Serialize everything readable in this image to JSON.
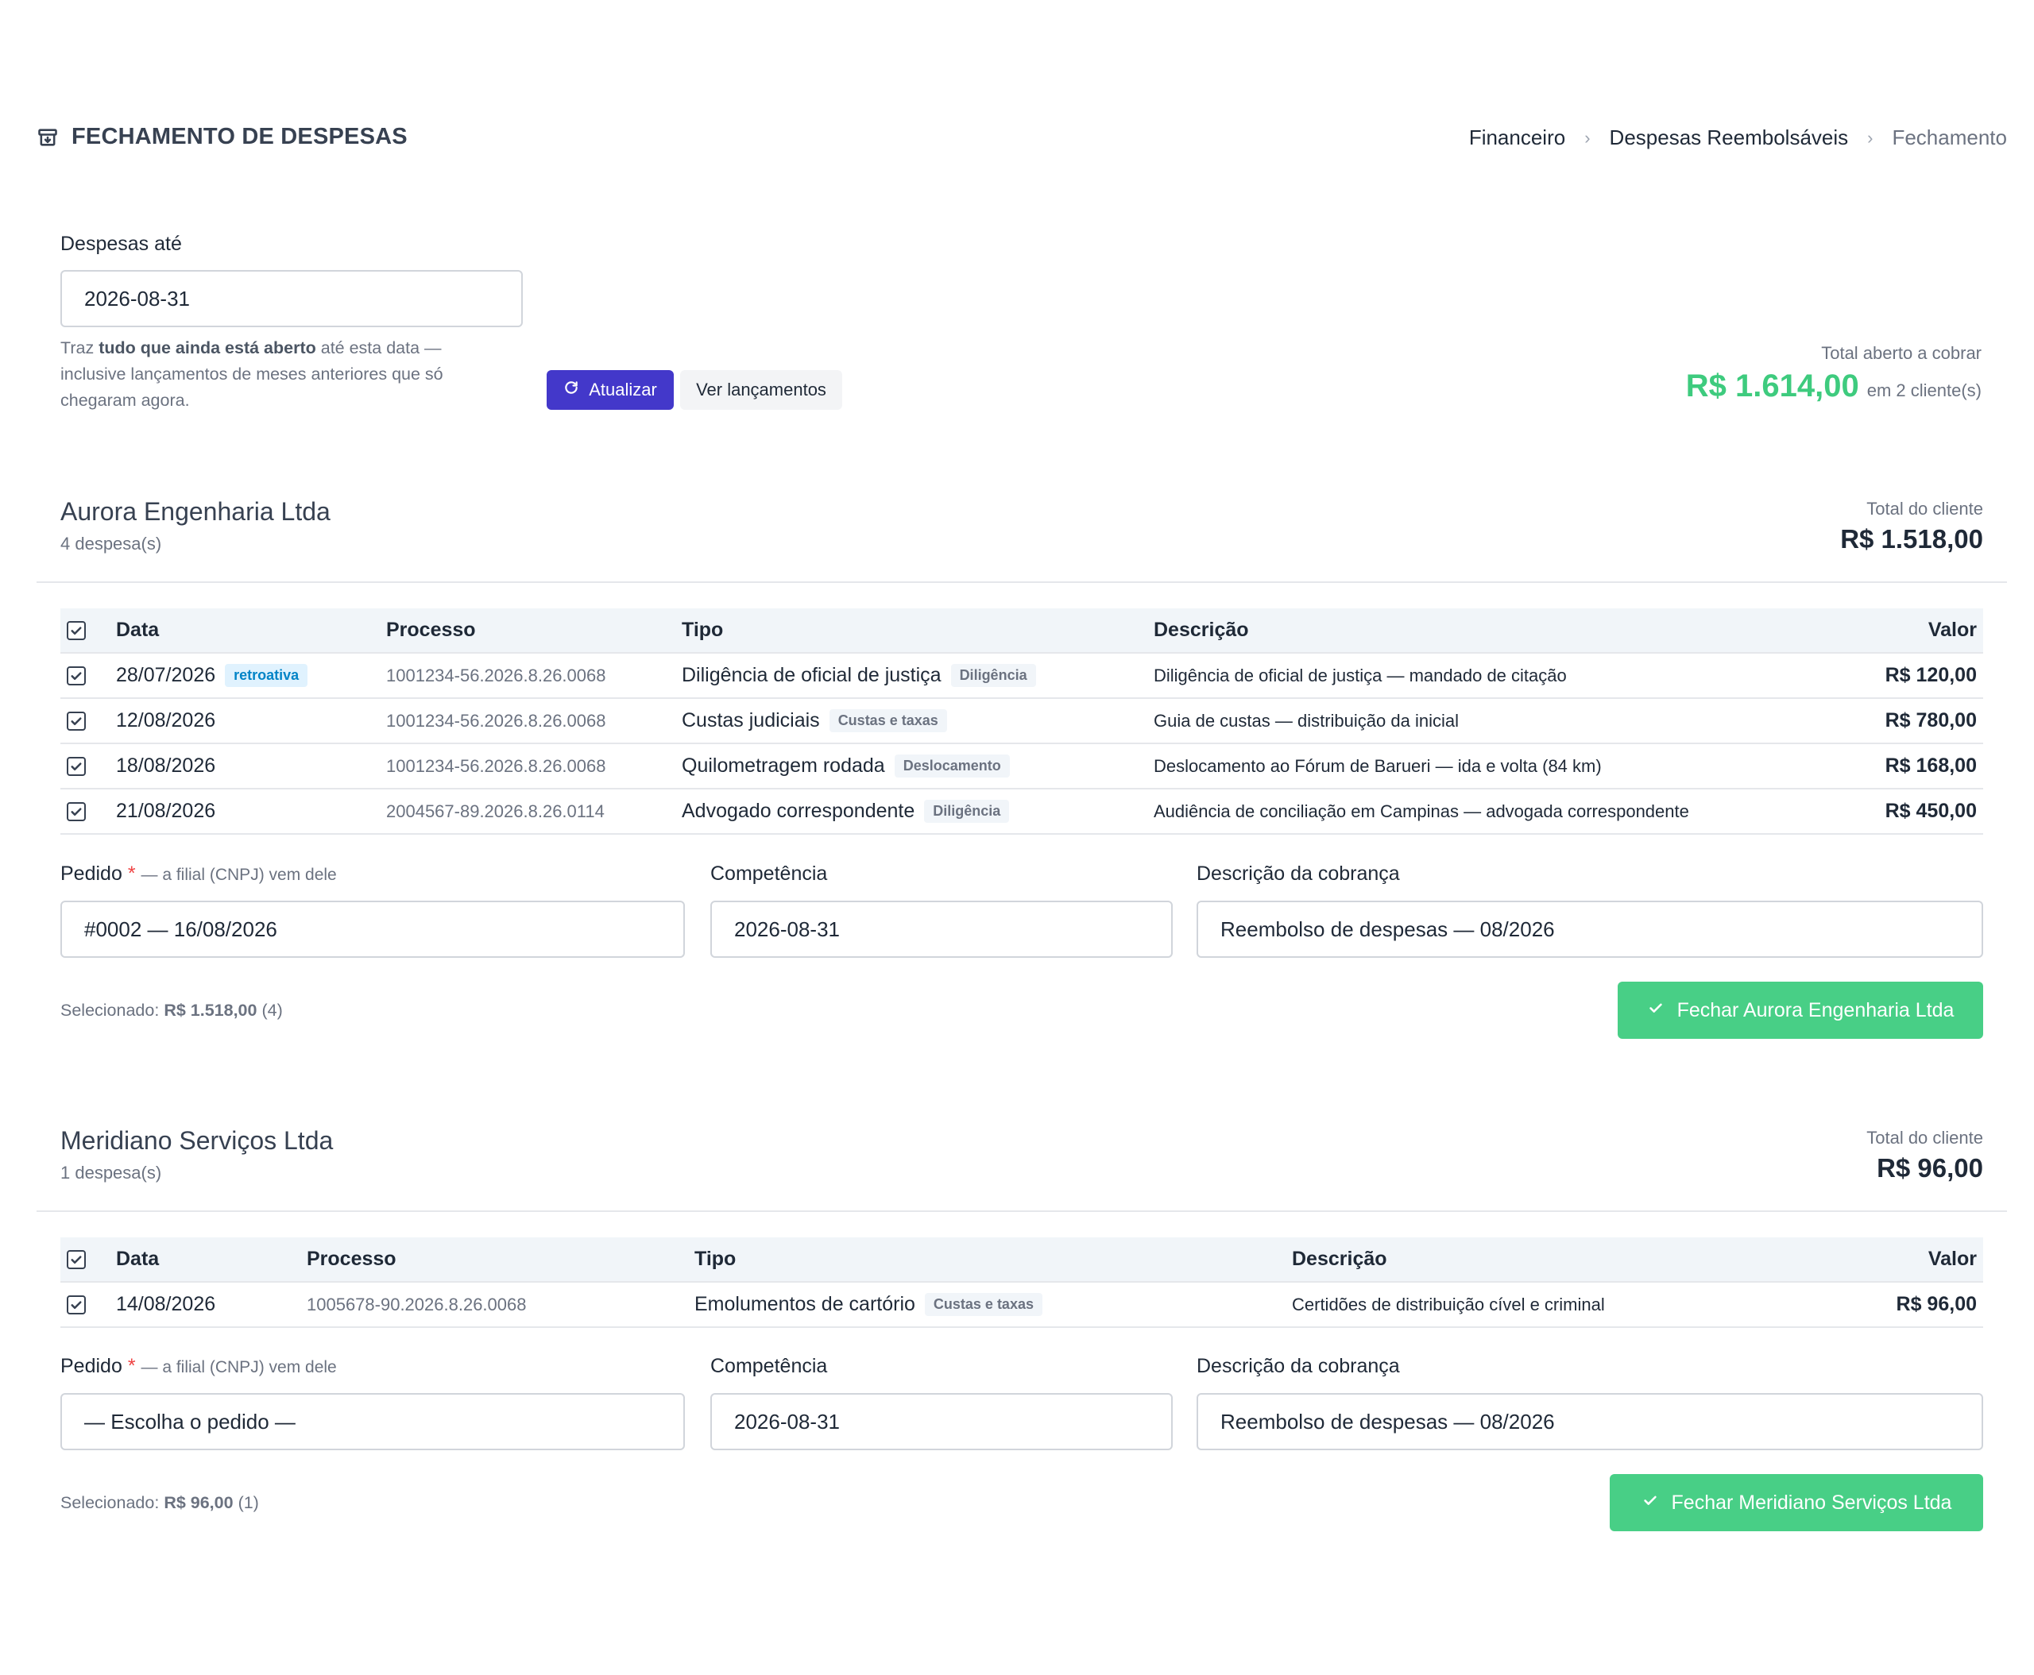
{
  "header": {
    "title": "FECHAMENTO DE DESPESAS",
    "breadcrumb": [
      "Financeiro",
      "Despesas Reembolsáveis",
      "Fechamento"
    ]
  },
  "filter": {
    "label": "Despesas até",
    "date_value": "2026-08-31",
    "help_prefix": "Traz ",
    "help_bold": "tudo que ainda está aberto",
    "help_suffix": " até esta data — inclusive lançamentos de meses anteriores que só chegaram agora.",
    "refresh_label": "Atualizar",
    "view_label": "Ver lançamentos"
  },
  "summary": {
    "label": "Total aberto a cobrar",
    "value": "R$ 1.614,00",
    "clients": "em 2 cliente(s)"
  },
  "columns": {
    "data": "Data",
    "processo": "Processo",
    "tipo": "Tipo",
    "descricao": "Descrição",
    "valor": "Valor"
  },
  "clients": [
    {
      "name": "Aurora Engenharia Ltda",
      "count": "4 despesa(s)",
      "total_label": "Total do cliente",
      "total": "R$ 1.518,00",
      "rows": [
        {
          "data": "28/07/2026",
          "badge": "retroativa",
          "processo": "1001234-56.2026.8.26.0068",
          "tipo": "Diligência de oficial de justiça",
          "categoria": "Diligência",
          "descricao": "Diligência de oficial de justiça — mandado de citação",
          "valor": "R$ 120,00"
        },
        {
          "data": "12/08/2026",
          "badge": "",
          "processo": "1001234-56.2026.8.26.0068",
          "tipo": "Custas judiciais",
          "categoria": "Custas e taxas",
          "descricao": "Guia de custas — distribuição da inicial",
          "valor": "R$ 780,00"
        },
        {
          "data": "18/08/2026",
          "badge": "",
          "processo": "1001234-56.2026.8.26.0068",
          "tipo": "Quilometragem rodada",
          "categoria": "Deslocamento",
          "descricao": "Deslocamento ao Fórum de Barueri — ida e volta (84 km)",
          "valor": "R$ 168,00"
        },
        {
          "data": "21/08/2026",
          "badge": "",
          "processo": "2004567-89.2026.8.26.0114",
          "tipo": "Advogado correspondente",
          "categoria": "Diligência",
          "descricao": "Audiência de conciliação em Campinas — advogada correspondente",
          "valor": "R$ 450,00"
        }
      ],
      "pedido_label": "Pedido",
      "pedido_required": "*",
      "pedido_hint": "— a filial (CNPJ) vem dele",
      "pedido_value": "#0002 — 16/08/2026",
      "competencia_label": "Competência",
      "competencia_value": "2026-08-31",
      "descricao_label": "Descrição da cobrança",
      "descricao_value": "Reembolso de despesas — 08/2026",
      "selected_prefix": "Selecionado:",
      "selected_value": "R$ 1.518,00",
      "selected_count": "(4)",
      "close_label": "Fechar Aurora Engenharia Ltda"
    },
    {
      "name": "Meridiano Serviços Ltda",
      "count": "1 despesa(s)",
      "total_label": "Total do cliente",
      "total": "R$ 96,00",
      "rows": [
        {
          "data": "14/08/2026",
          "badge": "",
          "processo": "1005678-90.2026.8.26.0068",
          "tipo": "Emolumentos de cartório",
          "categoria": "Custas e taxas",
          "descricao": "Certidões de distribuição cível e criminal",
          "valor": "R$ 96,00"
        }
      ],
      "pedido_label": "Pedido",
      "pedido_required": "*",
      "pedido_hint": "— a filial (CNPJ) vem dele",
      "pedido_value": "— Escolha o pedido —",
      "competencia_label": "Competência",
      "competencia_value": "2026-08-31",
      "descricao_label": "Descrição da cobrança",
      "descricao_value": "Reembolso de despesas — 08/2026",
      "selected_prefix": "Selecionado:",
      "selected_value": "R$ 96,00",
      "selected_count": "(1)",
      "close_label": "Fechar Meridiano Serviços Ltda"
    }
  ],
  "colors": {
    "accent": "#4338ca",
    "success": "#48cf86",
    "total_green": "#3ecb7e",
    "retro_badge": "#0284c7"
  },
  "icons": {
    "title": "archive-box-icon",
    "refresh": "refresh-icon",
    "check": "check-icon",
    "breadcrumb_sep": "chevron-right-icon"
  }
}
